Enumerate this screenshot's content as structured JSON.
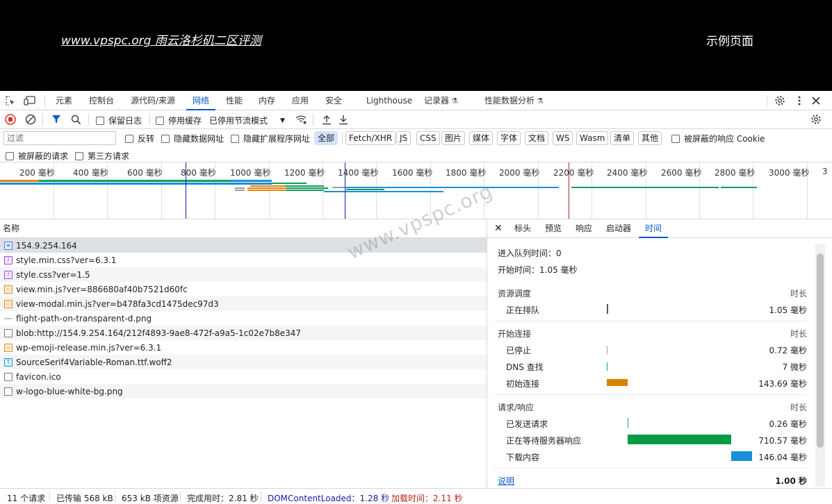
{
  "page": {
    "site_link": "www.vpspc.org 雨云洛杉矶二区评测",
    "nav_right": "示例页面"
  },
  "devtools": {
    "tabs": [
      {
        "label": "元素"
      },
      {
        "label": "控制台"
      },
      {
        "label": "源代码/来源"
      },
      {
        "label": "网络"
      },
      {
        "label": "性能"
      },
      {
        "label": "内存"
      },
      {
        "label": "应用"
      },
      {
        "label": "安全"
      },
      {
        "label": "Lighthouse"
      },
      {
        "label": "记录器"
      },
      {
        "label": "性能数据分析"
      }
    ],
    "active_tab": "网络"
  },
  "toolbar": {
    "preserve_log": "保留日志",
    "disable_cache": "停用缓存",
    "throttle": "已停用节流模式"
  },
  "filter": {
    "placeholder": "过滤",
    "invert": "反转",
    "hide_data_urls": "隐藏数据网址",
    "hide_ext_urls": "隐藏扩展程序网址",
    "types": [
      "全部",
      "Fetch/XHR",
      "JS",
      "CSS",
      "图片",
      "媒体",
      "字体",
      "文档",
      "WS",
      "Wasm",
      "清单",
      "其他"
    ],
    "blocked_cookies": "被屏蔽的响应 Cookie",
    "blocked_requests": "被屏蔽的请求",
    "third_party": "第三方请求"
  },
  "overview": {
    "ticks": [
      "200 毫秒",
      "400 毫秒",
      "600 毫秒",
      "800 毫秒",
      "1000 毫秒",
      "1200 毫秒",
      "1400 毫秒",
      "1600 毫秒",
      "1800 毫秒",
      "2000 毫秒",
      "2200 毫秒",
      "2400 毫秒",
      "2600 毫秒",
      "2800 毫秒",
      "3000 毫秒",
      "3"
    ],
    "colors": {
      "waiting": "#0f9d58",
      "download": "#1a8fd9",
      "connect": "#e8830c",
      "queue": "#9e9e9e",
      "dom": "#1a1aa8",
      "load": "#b3261e",
      "blue_marker": "#1a1aa8"
    }
  },
  "requests": {
    "header": "名称",
    "rows": [
      {
        "name": "154.9.254.164",
        "type": "doc"
      },
      {
        "name": "style.min.css?ver=6.3.1",
        "type": "css"
      },
      {
        "name": "style.css?ver=1.5",
        "type": "css"
      },
      {
        "name": "view.min.js?ver=886680af40b7521d60fc",
        "type": "js"
      },
      {
        "name": "view-modal.min.js?ver=b478fa3cd1475dec97d3",
        "type": "js"
      },
      {
        "name": "flight-path-on-transparent-d.png",
        "type": "img"
      },
      {
        "name": "blob:http://154.9.254.164/212f4893-9ae8-472f-a9a5-1c02e7b8e347",
        "type": "other"
      },
      {
        "name": "wp-emoji-release.min.js?ver=6.3.1",
        "type": "js"
      },
      {
        "name": "SourceSerif4Variable-Roman.ttf.woff2",
        "type": "font"
      },
      {
        "name": "favicon.ico",
        "type": "other"
      },
      {
        "name": "w-logo-blue-white-bg.png",
        "type": "other"
      }
    ]
  },
  "detail": {
    "tabs": [
      "标头",
      "预览",
      "响应",
      "启动器",
      "时间"
    ],
    "active_tab": "时间",
    "queued_at": "进入队列时间：0",
    "started_at": "开始时间：1.05 毫秒",
    "duration_label": "时长",
    "sections": [
      {
        "title": "资源调度",
        "items": [
          {
            "label": "正在排队",
            "value": "1.05 毫秒",
            "color": "#555555"
          }
        ]
      },
      {
        "title": "开始连接",
        "items": [
          {
            "label": "已停止",
            "value": "0.72 毫秒",
            "color": "#9e9e9e"
          },
          {
            "label": "DNS 查找",
            "value": "7 微秒",
            "color": "#0f9d8c"
          },
          {
            "label": "初始连接",
            "value": "143.69 毫秒",
            "color": "#d98300"
          }
        ]
      },
      {
        "title": "请求/响应",
        "items": [
          {
            "label": "已发送请求",
            "value": "0.26 毫秒",
            "color": "#0f9d58"
          },
          {
            "label": "正在等待服务器响应",
            "value": "710.57 毫秒",
            "color": "#0a9b47"
          },
          {
            "label": "下载内容",
            "value": "146.04 毫秒",
            "color": "#1a8fd9"
          }
        ]
      }
    ],
    "explain": "说明",
    "total": "1.00 秒"
  },
  "status": {
    "requests": "11 个请求",
    "transferred": "已传输 568 kB",
    "resources": "653 kB 项资源",
    "finish": "完成用时：2.81 秒",
    "dcl": "DOMContentLoaded：1.28 秒",
    "load": "加载时间：2.11 秒",
    "dcl_color": "#1a1aa8",
    "load_color": "#b3261e"
  },
  "watermark": "www.vpspc.org"
}
